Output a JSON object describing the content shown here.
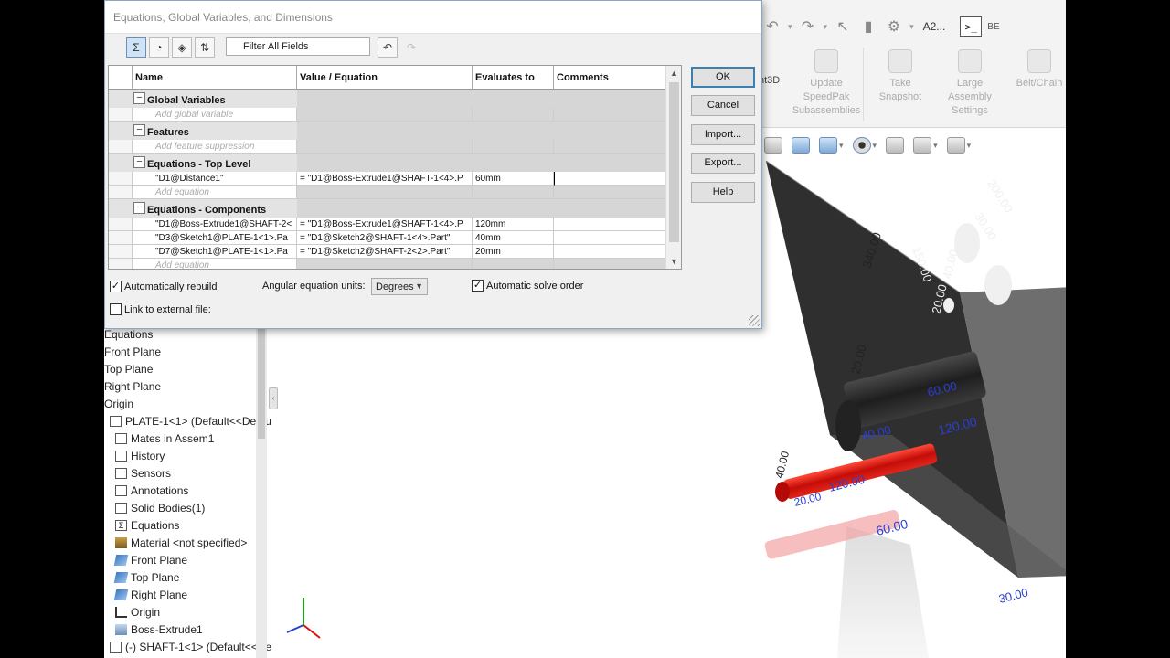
{
  "dialog": {
    "title": "Equations, Global Variables, and Dimensions",
    "filter_placeholder": "Filter All Fields",
    "columns": [
      "Name",
      "Value / Equation",
      "Evaluates to",
      "Comments"
    ],
    "sections": {
      "global": {
        "title": "Global Variables",
        "add": "Add global variable"
      },
      "features": {
        "title": "Features",
        "add": "Add feature suppression"
      },
      "top": {
        "title": "Equations - Top Level",
        "rows": [
          {
            "name": "\"D1@Distance1\"",
            "value": "= \"D1@Boss-Extrude1@SHAFT-1<4>.P",
            "eval": "60mm"
          }
        ],
        "add": "Add equation"
      },
      "components": {
        "title": "Equations - Components",
        "rows": [
          {
            "name": "\"D1@Boss-Extrude1@SHAFT-2<",
            "value": "= \"D1@Boss-Extrude1@SHAFT-1<4>.P",
            "eval": "120mm"
          },
          {
            "name": "\"D3@Sketch1@PLATE-1<1>.Pa",
            "value": "= \"D1@Sketch2@SHAFT-1<4>.Part\"",
            "eval": "40mm"
          },
          {
            "name": "\"D7@Sketch1@PLATE-1<1>.Pa",
            "value": "= \"D1@Sketch2@SHAFT-2<2>.Part\"",
            "eval": "20mm"
          }
        ],
        "add": "Add equation"
      }
    },
    "buttons": {
      "ok": "OK",
      "cancel": "Cancel",
      "import": "Import...",
      "export": "Export...",
      "help": "Help"
    },
    "options": {
      "auto_rebuild": "Automatically rebuild",
      "angular_label": "Angular equation units:",
      "angular_value": "Degrees",
      "auto_solve": "Automatic solve order",
      "link_external": "Link to external file:"
    }
  },
  "ribbon": {
    "user_label": "A2...",
    "cmd_label": "BE",
    "partial_tool": "nt3D",
    "tools": [
      {
        "l1": "Update",
        "l2": "SpeedPak",
        "l3": "Subassemblies"
      },
      {
        "l1": "Take",
        "l2": "Snapshot",
        "l3": ""
      },
      {
        "l1": "Large",
        "l2": "Assembly",
        "l3": "Settings"
      },
      {
        "l1": "Belt/Chain",
        "l2": "",
        "l3": ""
      }
    ]
  },
  "tree": [
    {
      "label": "Equations",
      "icon": "sum-icon"
    },
    {
      "label": "Front Plane",
      "icon": "plane-icon"
    },
    {
      "label": "Top Plane",
      "icon": "plane-icon"
    },
    {
      "label": "Right Plane",
      "icon": "plane-icon"
    },
    {
      "label": "Origin",
      "icon": "origin-icon"
    },
    {
      "label": "PLATE-1<1> (Default<<Defau",
      "icon": "part-icon"
    },
    {
      "label": "Mates in Assem1",
      "icon": "mates-folder-icon"
    },
    {
      "label": "History",
      "icon": "history-folder-icon"
    },
    {
      "label": "Sensors",
      "icon": "sensors-folder-icon"
    },
    {
      "label": "Annotations",
      "icon": "annotations-folder-icon"
    },
    {
      "label": "Solid Bodies(1)",
      "icon": "solid-bodies-folder-icon"
    },
    {
      "label": "Equations",
      "icon": "sum-icon"
    },
    {
      "label": "Material <not specified>",
      "icon": "material-icon"
    },
    {
      "label": "Front Plane",
      "icon": "plane-icon"
    },
    {
      "label": "Top Plane",
      "icon": "plane-icon"
    },
    {
      "label": "Right Plane",
      "icon": "plane-icon"
    },
    {
      "label": "Origin",
      "icon": "origin-icon"
    },
    {
      "label": "Boss-Extrude1",
      "icon": "extrude-icon"
    },
    {
      "label": "(-) SHAFT-1<1> (Default<<De",
      "icon": "part-icon"
    }
  ],
  "model": {
    "dims": [
      "200.00",
      "30.00",
      "150.00",
      "340.00",
      "40.00",
      "20.00",
      "20.00",
      "60.00",
      "120.00",
      "40.00",
      "40.00",
      "120.00",
      "20.00",
      "60.00",
      "30.00"
    ]
  },
  "colors": {
    "accent": "#3c7fb1",
    "plate": "#2f2f2f",
    "shaft_red": "#d9120c",
    "dim_blue": "#2a3fd6"
  }
}
